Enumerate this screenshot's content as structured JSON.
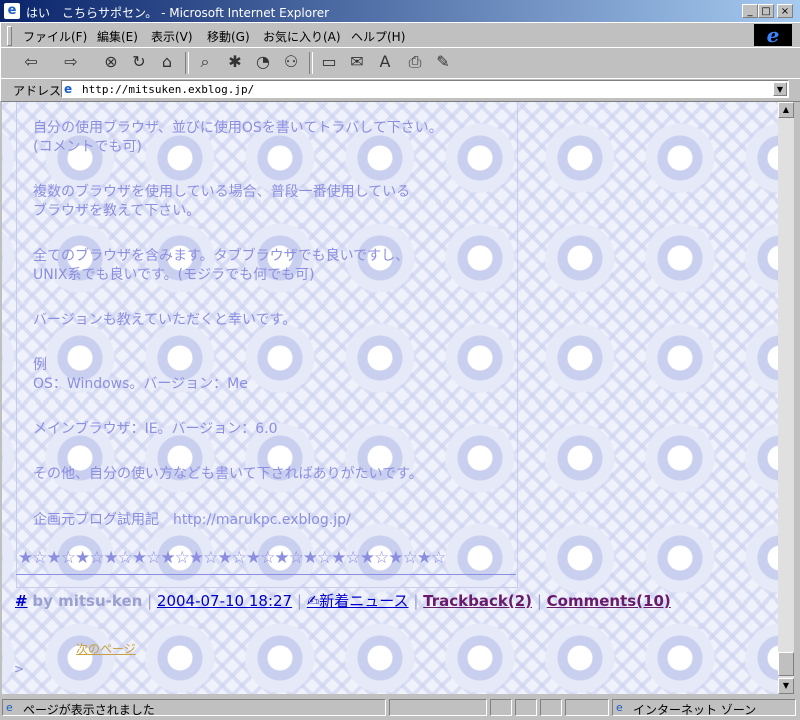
{
  "window": {
    "title": "はい　こちらサポセン。 - Microsoft Internet Explorer",
    "minimize_glyph": "_",
    "maximize_glyph": "□",
    "close_glyph": "×"
  },
  "menu": [
    "ファイル(F)",
    "編集(E)",
    "表示(V)",
    "移動(G)",
    "お気に入り(A)",
    "ヘルプ(H)"
  ],
  "ie_logo": "e",
  "toolbar_icons": {
    "back": "⇦",
    "forward": "⇨",
    "stop": "⊗",
    "refresh": "↻",
    "home": "⌂",
    "search": "⌕",
    "favorites": "✱",
    "history": "◔",
    "channels": "⚇",
    "fullscreen": "▭",
    "mail": "✉",
    "font": "A",
    "print": "⎙",
    "edit": "✎"
  },
  "address": {
    "label": "アドレス",
    "page_icon": "e",
    "url": "http://mitsuken.exblog.jp/"
  },
  "article": {
    "lines": [
      "自分の使用ブラウザ、並びに使用OSを書いてトラバして下さい。",
      "(コメントでも可)",
      "複数のブラウザを使用している場合、普段一番使用している",
      "ブラウザを教えて下さい。",
      "全てのブラウザを含みます。タブブラウザでも良いですし、",
      "UNIX系でも良いです。(モジラでも何でも可)",
      "バージョンも教えていただくと幸いです。",
      "例",
      "OS：Windows。バージョン：Me",
      "メインブラウザ：IE。バージョン：6.0",
      "その他、自分の使い方なども書いて下さればありがたいです。",
      "企画元ブログ試用記　http://marukpc.exblog.jp/"
    ],
    "stars": "★☆★☆★☆★☆★☆★☆★☆★☆★☆★☆★☆★☆★☆★☆★☆"
  },
  "footer": {
    "anchor": "#",
    "by": "by mitsu-ken",
    "sep": "|",
    "date": "2004-07-10 18:27",
    "news": "✍新着ニュース",
    "trackback": "Trackback(2)",
    "comments": "Comments(10)"
  },
  "next_page": "次のページ",
  "caret": ">",
  "status": {
    "text": "ページが表示されました",
    "zone": "インターネット ゾーン"
  }
}
